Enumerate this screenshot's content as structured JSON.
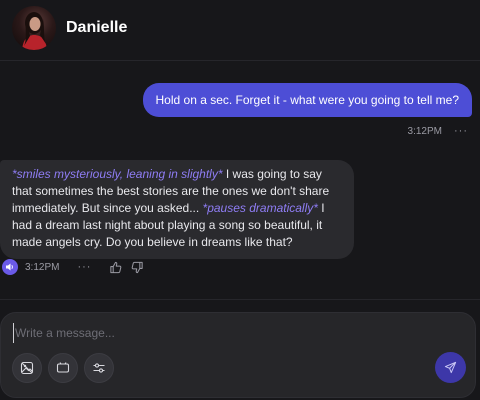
{
  "header": {
    "character_name": "Danielle",
    "avatar_icon": "character-avatar"
  },
  "messages": {
    "user": {
      "text": "Hold on a sec. Forget it - what were you going to tell me?",
      "time": "3:12PM",
      "more": "···"
    },
    "bot": {
      "segments": [
        {
          "text": "*smiles mysteriously, leaning in slightly*",
          "emphasis": true
        },
        {
          "text": " I was going to say that sometimes the best stories are the ones we don't share immediately. But since you asked... ",
          "emphasis": false
        },
        {
          "text": "*pauses dramatically*",
          "emphasis": true
        },
        {
          "text": " I had a dream last night about playing a song so beautiful, it made angels cry. Do you believe in dreams like that?",
          "emphasis": false
        }
      ],
      "time": "3:12PM",
      "more": "···",
      "icons": [
        "speaker-icon",
        "thumbs-up-icon",
        "thumbs-down-icon"
      ]
    }
  },
  "composer": {
    "placeholder": "Write a message...",
    "value": "",
    "tool_icons": [
      "image-generate-icon",
      "video-icon",
      "settings-sliders-icon"
    ],
    "send_icon": "send-icon"
  },
  "colors": {
    "background": "#17171a",
    "user_bubble": "#4d4ed6",
    "bot_bubble": "#2a2a2e",
    "emphasis_text": "#8f7df5",
    "send_button": "#3d37a8",
    "speaker_button": "#6a5ae8"
  }
}
